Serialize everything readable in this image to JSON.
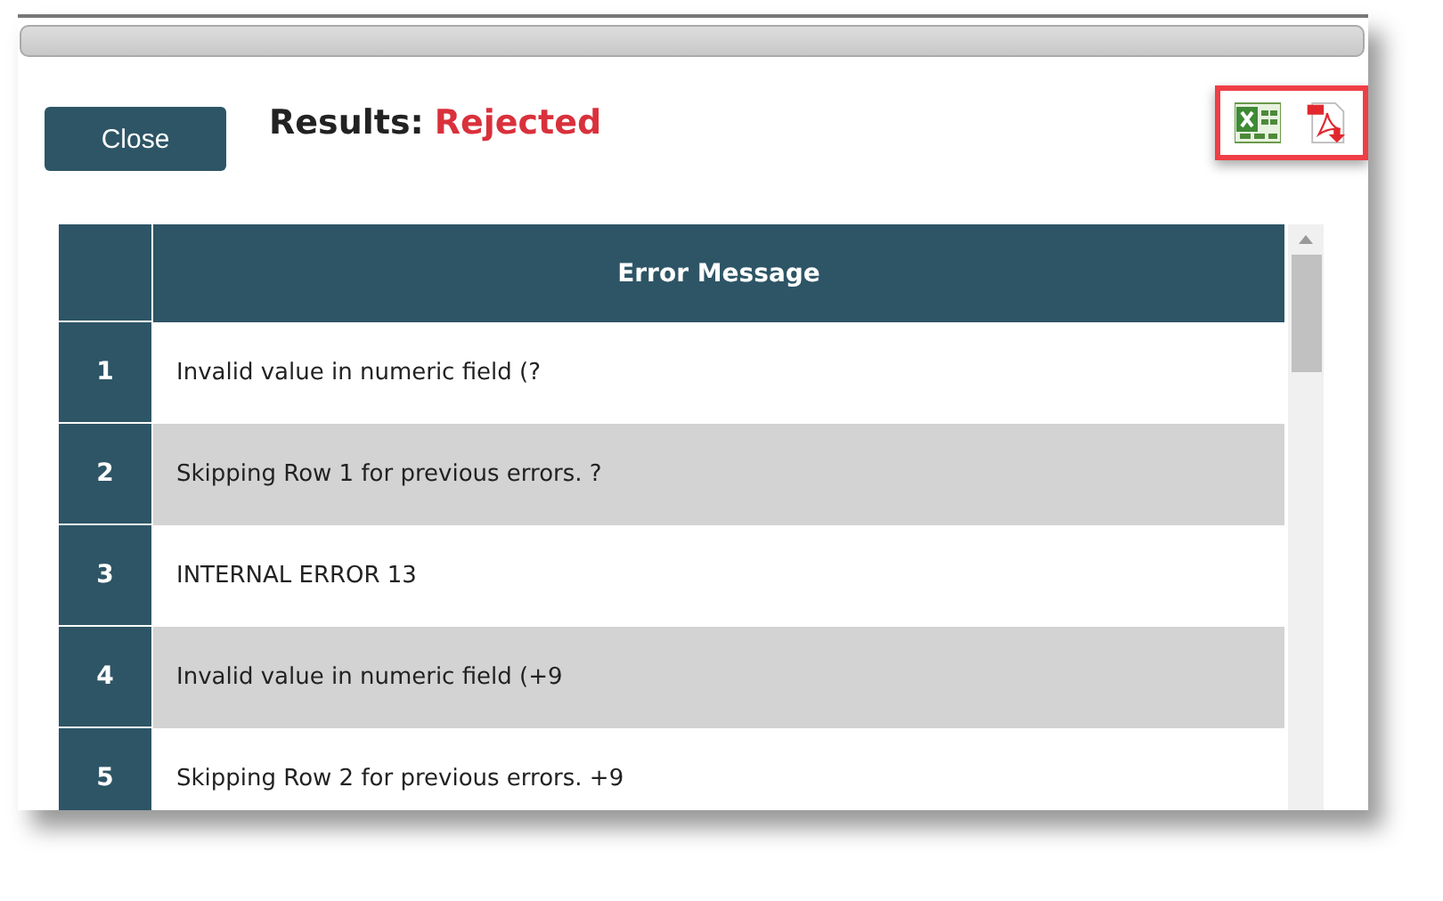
{
  "close_button": "Close",
  "results": {
    "label": "Results:",
    "status": "Rejected"
  },
  "table": {
    "columns": [
      "Error Message"
    ],
    "rows": [
      {
        "number": "1",
        "message": "Invalid value in numeric field (?"
      },
      {
        "number": "2",
        "message": "Skipping Row 1 for previous errors. ?"
      },
      {
        "number": "3",
        "message": "INTERNAL ERROR 13"
      },
      {
        "number": "4",
        "message": "Invalid value in numeric field (+9"
      },
      {
        "number": "5",
        "message": "Skipping Row 2 for previous errors. +9"
      }
    ]
  }
}
